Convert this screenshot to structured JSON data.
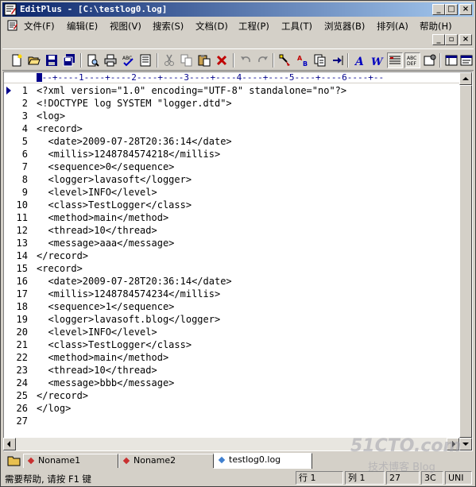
{
  "window": {
    "app_name": "EditPlus",
    "title": "EditPlus - [C:\\testlog0.log]",
    "caption_buttons": [
      "minimize",
      "restore",
      "close"
    ]
  },
  "menu": {
    "items": [
      {
        "label": "文件(F)"
      },
      {
        "label": "编辑(E)"
      },
      {
        "label": "视图(V)"
      },
      {
        "label": "搜索(S)"
      },
      {
        "label": "文档(D)"
      },
      {
        "label": "工程(P)"
      },
      {
        "label": "工具(T)"
      },
      {
        "label": "浏览器(B)"
      },
      {
        "label": "排列(A)"
      },
      {
        "label": "帮助(H)"
      }
    ]
  },
  "toolbar": {
    "buttons": [
      "new-file",
      "open",
      "save",
      "save-all",
      "print-preview",
      "print",
      "spell-check",
      "properties",
      "cut",
      "copy",
      "paste",
      "delete",
      "undo",
      "redo",
      "find",
      "replace",
      "find-in-files",
      "goto",
      "font",
      "word-wrap",
      "line-numbers",
      "ruler",
      "column-select",
      "settings",
      "window",
      "browser"
    ]
  },
  "editor": {
    "ruler": "---+----1----+----2----+----3----+----4----+----5----+----6----+--",
    "lines": [
      "<?xml version=\"1.0\" encoding=\"UTF-8\" standalone=\"no\"?>",
      "<!DOCTYPE log SYSTEM \"logger.dtd\">",
      "<log>",
      "<record>",
      "  <date>2009-07-28T20:36:14</date>",
      "  <millis>1248784574218</millis>",
      "  <sequence>0</sequence>",
      "  <logger>lavasoft</logger>",
      "  <level>INFO</level>",
      "  <class>TestLogger</class>",
      "  <method>main</method>",
      "  <thread>10</thread>",
      "  <message>aaa</message>",
      "</record>",
      "<record>",
      "  <date>2009-07-28T20:36:14</date>",
      "  <millis>1248784574234</millis>",
      "  <sequence>1</sequence>",
      "  <logger>lavasoft.blog</logger>",
      "  <level>INFO</level>",
      "  <class>TestLogger</class>",
      "  <method>main</method>",
      "  <thread>10</thread>",
      "  <message>bbb</message>",
      "</record>",
      "</log>",
      ""
    ]
  },
  "tabs": [
    {
      "label": "Noname1",
      "icon": "red-diamond-icon",
      "active": false
    },
    {
      "label": "Noname2",
      "icon": "red-diamond-icon",
      "active": false
    },
    {
      "label": "testlog0.log",
      "icon": "blue-diamond-icon",
      "active": true
    }
  ],
  "status": {
    "help": "需要帮助, 请按 F1 键",
    "row": "行 1",
    "col": "列 1",
    "total_lines": "27",
    "encoding": "3C",
    "line_ending": "UNI"
  },
  "watermark": {
    "logo": "51CTO.com",
    "sub": "技术博客 Blog"
  },
  "colors": {
    "titlebar_start": "#0a246a",
    "titlebar_end": "#a6caf0",
    "ruler": "#00008b",
    "chrome": "#d4d0c8"
  }
}
